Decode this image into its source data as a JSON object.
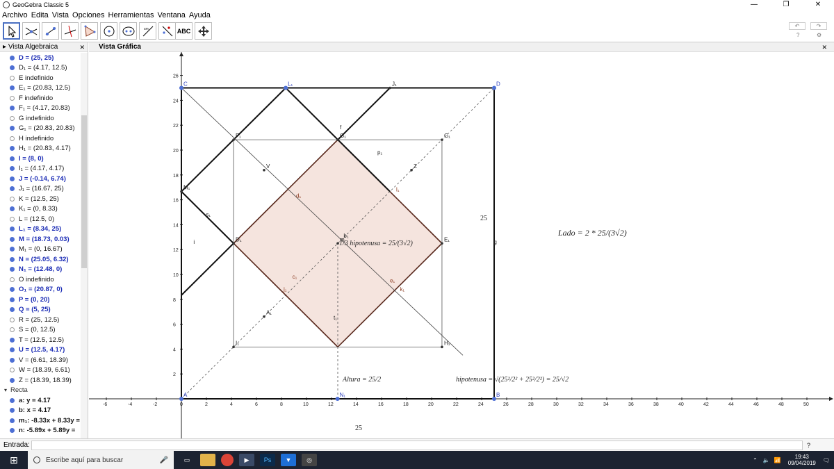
{
  "window": {
    "title": "GeoGebra Classic 5",
    "controls": [
      "—",
      "❐",
      "✕"
    ]
  },
  "menu": [
    "Archivo",
    "Edita",
    "Vista",
    "Opciones",
    "Herramientas",
    "Ventana",
    "Ayuda"
  ],
  "toolbar": {
    "tools": [
      {
        "name": "move-tool",
        "icon": "arrow-icon"
      },
      {
        "name": "point-tool",
        "icon": "intersect-icon"
      },
      {
        "name": "line-tool",
        "icon": "line-icon"
      },
      {
        "name": "perpendicular-tool",
        "icon": "perpendicular-icon"
      },
      {
        "name": "polygon-tool",
        "icon": "polygon-icon"
      },
      {
        "name": "circle-tool",
        "icon": "circle-icon"
      },
      {
        "name": "conic-tool",
        "icon": "ellipse-icon"
      },
      {
        "name": "angle-tool",
        "icon": "angle-icon"
      },
      {
        "name": "reflect-tool",
        "icon": "reflect-icon"
      },
      {
        "name": "text-tool",
        "icon": "text-icon",
        "label": "ABC"
      },
      {
        "name": "move-view-tool",
        "icon": "move-view-icon"
      }
    ],
    "undo_label": "↶",
    "redo_label": "↷",
    "help_icon": "?",
    "settings_icon": "⚙"
  },
  "algebra_view": {
    "title": "Vista Algebraica",
    "items": [
      {
        "t": "D = (25, 25)",
        "s": "on",
        "c": "blue"
      },
      {
        "t": "D₁ = (4.17, 12.5)",
        "s": "on",
        "c": "black"
      },
      {
        "t": "E indefinido",
        "s": "off",
        "c": "black"
      },
      {
        "t": "E₁ = (20.83, 12.5)",
        "s": "on",
        "c": "black"
      },
      {
        "t": "F indefinido",
        "s": "off",
        "c": "black"
      },
      {
        "t": "F₁ = (4.17, 20.83)",
        "s": "on",
        "c": "black"
      },
      {
        "t": "G indefinido",
        "s": "off",
        "c": "black"
      },
      {
        "t": "G₁ = (20.83, 20.83)",
        "s": "on",
        "c": "black"
      },
      {
        "t": "H indefinido",
        "s": "off",
        "c": "black"
      },
      {
        "t": "H₁ = (20.83, 4.17)",
        "s": "on",
        "c": "black"
      },
      {
        "t": "I = (8, 0)",
        "s": "on",
        "c": "blue"
      },
      {
        "t": "I₁ = (4.17, 4.17)",
        "s": "on",
        "c": "black"
      },
      {
        "t": "J = (-0.14, 6.74)",
        "s": "on",
        "c": "blue"
      },
      {
        "t": "J₁ = (16.67, 25)",
        "s": "on",
        "c": "black"
      },
      {
        "t": "K = (12.5, 25)",
        "s": "off",
        "c": "black"
      },
      {
        "t": "K₁ = (0, 8.33)",
        "s": "on",
        "c": "black"
      },
      {
        "t": "L = (12.5, 0)",
        "s": "off",
        "c": "black"
      },
      {
        "t": "L₁ = (8.34, 25)",
        "s": "on",
        "c": "blue"
      },
      {
        "t": "M = (18.73, 0.03)",
        "s": "on",
        "c": "blue"
      },
      {
        "t": "M₁ = (0, 16.67)",
        "s": "on",
        "c": "black"
      },
      {
        "t": "N = (25.05, 6.32)",
        "s": "on",
        "c": "blue"
      },
      {
        "t": "N₁ = (12.48, 0)",
        "s": "on",
        "c": "blue"
      },
      {
        "t": "O indefinido",
        "s": "off",
        "c": "black"
      },
      {
        "t": "O₁ = (20.87, 0)",
        "s": "on",
        "c": "blue"
      },
      {
        "t": "P = (0, 20)",
        "s": "on",
        "c": "blue"
      },
      {
        "t": "Q = (5, 25)",
        "s": "on",
        "c": "blue"
      },
      {
        "t": "R = (25, 12.5)",
        "s": "off",
        "c": "black"
      },
      {
        "t": "S = (0, 12.5)",
        "s": "off",
        "c": "black"
      },
      {
        "t": "T = (12.5, 12.5)",
        "s": "on",
        "c": "black"
      },
      {
        "t": "U = (12.5, 4.17)",
        "s": "on",
        "c": "blue"
      },
      {
        "t": "V = (6.61, 18.39)",
        "s": "on",
        "c": "black"
      },
      {
        "t": "W = (18.39, 6.61)",
        "s": "off",
        "c": "black"
      },
      {
        "t": "Z = (18.39, 18.39)",
        "s": "on",
        "c": "black"
      }
    ],
    "category": "Recta",
    "lines": [
      {
        "t": "a: y = 4.17",
        "s": "on"
      },
      {
        "t": "b: x = 4.17",
        "s": "on"
      },
      {
        "t": "m₁: -8.33x + 8.33y =",
        "s": "on"
      },
      {
        "t": "n: -5.89x + 5.89y =",
        "s": "on"
      }
    ]
  },
  "graphics_view": {
    "title": "Vista Gráfica",
    "x_ticks": [
      "-6",
      "-4",
      "-2",
      "0",
      "2",
      "4",
      "6",
      "8",
      "10",
      "12",
      "14",
      "16",
      "18",
      "20",
      "22",
      "24",
      "26",
      "28",
      "30",
      "32",
      "34",
      "36",
      "38",
      "40",
      "42",
      "44",
      "46",
      "48",
      "50"
    ],
    "y_ticks": [
      "2",
      "4",
      "6",
      "8",
      "10",
      "12",
      "14",
      "16",
      "18",
      "20",
      "22",
      "24",
      "26"
    ],
    "point_labels": [
      "C",
      "D",
      "L₁",
      "J₁",
      "f",
      "F₁",
      "G₁",
      "G₁",
      "V",
      "Z",
      "p₁",
      "M₁",
      "s₁",
      "D₁",
      "i",
      "m",
      "E₁",
      "g",
      "A₁",
      "I₁",
      "H₁",
      "t₁",
      "N₁",
      "A",
      "B",
      "d₁",
      "l₁",
      "j₁",
      "k₁",
      "e₁",
      "c₁",
      "b₁"
    ],
    "formula_inside": "1/3 hipotenusa = 25/(3√2)",
    "formula_lado": "Lado = 2 * 25/(3√2)",
    "formula_altura": "Altura = 25/2",
    "formula_hipotenusa": "hipotenusa = √(25²/2² + 25²/2²) = 25/√2",
    "label_25_right": "25",
    "label_25_bottom": "25"
  },
  "input_bar": {
    "label": "Entrada:",
    "value": ""
  },
  "taskbar": {
    "search_placeholder": "Escribe aquí para buscar",
    "time": "19:43",
    "date": "09/04/2019"
  },
  "colors": {
    "accent": "#4d6fd4",
    "shade": "#f5e4de",
    "shade_border": "#5a2a1e",
    "axis": "#222"
  }
}
